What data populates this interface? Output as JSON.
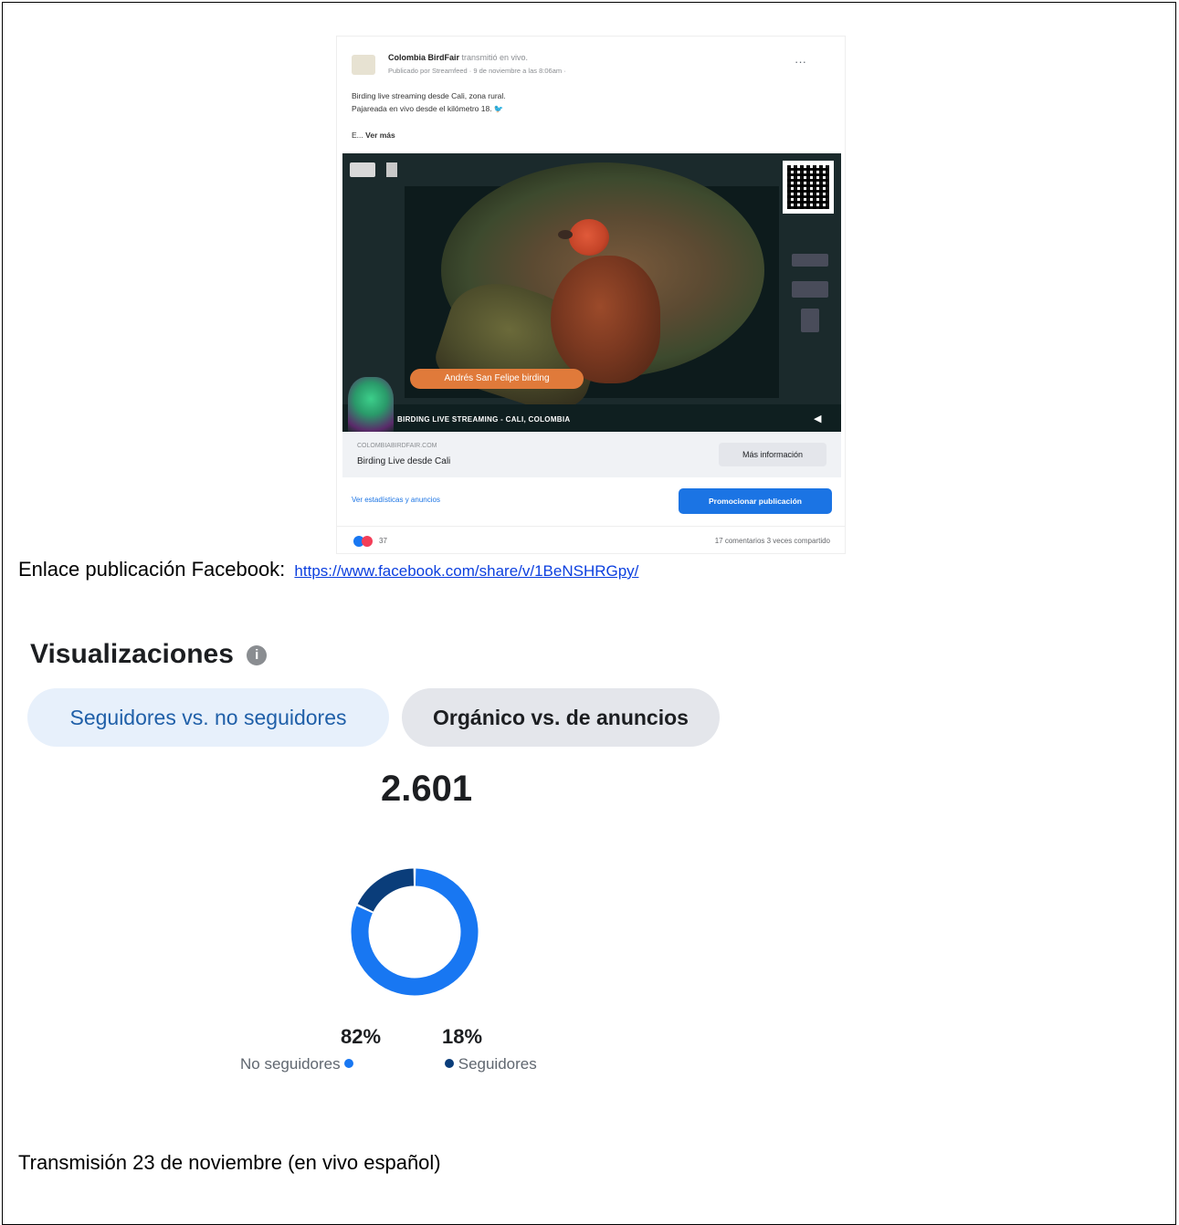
{
  "facebook_post": {
    "page_name": "Colombia BirdFair",
    "page_action": "transmitió en vivo.",
    "meta": "Publicado por Streamfeed · 9 de noviembre a las 8:06am ·",
    "body_line1": "Birding live streaming desde Cali, zona rural.",
    "body_line2": "Pajareada en vivo desde el kilómetro 18. 🐦",
    "see_more_prefix": "E...",
    "see_more": "Ver más",
    "video_tag": "Andrés San Felipe birding",
    "video_bottom_text": "BIRDING LIVE STREAMING - CALI, COLOMBIA",
    "link_domain": "COLOMBIABIRDFAIR.COM",
    "link_title": "Birding Live desde Cali",
    "link_button": "Más información",
    "stats_link": "Ver estadísticas y anuncios",
    "promote_button": "Promocionar publicación",
    "reactions_count": "37",
    "comments_shares": "17 comentarios   3 veces compartido"
  },
  "document": {
    "link_label": "Enlace publicación Facebook:",
    "link_url": "https://www.facebook.com/share/v/1BeNSHRGpy/",
    "transmission_caption": "Transmisión 23 de noviembre (en vivo español)"
  },
  "insights": {
    "title": "Visualizaciones",
    "info_icon": "i",
    "tabs": [
      {
        "label": "Seguidores vs. no seguidores",
        "active": true
      },
      {
        "label": "Orgánico vs. de anuncios",
        "active": false
      }
    ],
    "total": "2.601"
  },
  "chart_data": {
    "type": "pie",
    "donut": true,
    "total": "2.601",
    "series": [
      {
        "name": "No seguidores",
        "value": 82,
        "label": "82%",
        "color": "#1877f2"
      },
      {
        "name": "Seguidores",
        "value": 18,
        "label": "18%",
        "color": "#0a3d7a"
      }
    ]
  }
}
